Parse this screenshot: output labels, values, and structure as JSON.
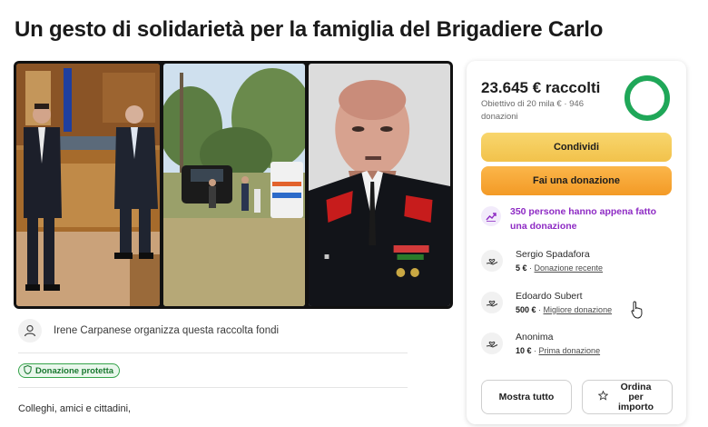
{
  "page": {
    "title": "Un gesto di solidarietà per la famiglia del Brigadiere Carlo"
  },
  "organizer": {
    "text": "Irene Carpanese organizza questa raccolta fondi",
    "icon": "user-icon"
  },
  "badge": {
    "label": "Donazione protetta",
    "icon": "shield-icon",
    "color": "#35a34a"
  },
  "story": {
    "intro": "Colleghi, amici e cittadini,"
  },
  "donation": {
    "raised": "23.645 € raccolti",
    "goal": "Obiettivo di 20 mila € · 946 donazioni",
    "progress_fraction": 1.0,
    "share_label": "Condividi",
    "donate_label": "Fai una donazione",
    "trend_text": "350 persone hanno appena fatto una donazione",
    "accent_color": "#8e2bc4",
    "ring_color": "#1fa758",
    "donors": [
      {
        "name": "Sergio Spadafora",
        "amount": "5 €",
        "note": "Donazione recente"
      },
      {
        "name": "Edoardo Subert",
        "amount": "500 €",
        "note": "Migliore donazione"
      },
      {
        "name": "Anonima",
        "amount": "10 €",
        "note": "Prima donazione"
      }
    ],
    "show_all_label": "Mostra tutto",
    "sort_label": "Ordina per importo"
  }
}
